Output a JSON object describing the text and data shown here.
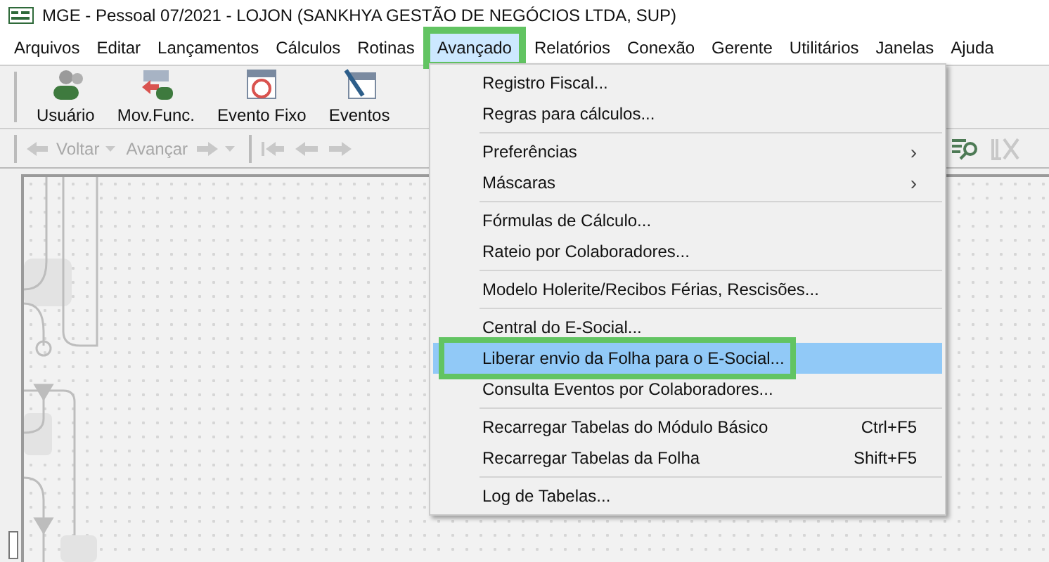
{
  "window": {
    "title": "MGE - Pessoal 07/2021 - LOJON (SANKHYA GESTÃO DE NEGÓCIOS LTDA, SUP)"
  },
  "menubar": [
    {
      "label": "Arquivos",
      "selected": false,
      "highlighted": false
    },
    {
      "label": "Editar",
      "selected": false,
      "highlighted": false
    },
    {
      "label": "Lançamentos",
      "selected": false,
      "highlighted": false
    },
    {
      "label": "Cálculos",
      "selected": false,
      "highlighted": false
    },
    {
      "label": "Rotinas",
      "selected": false,
      "highlighted": false
    },
    {
      "label": "Avançado",
      "selected": true,
      "highlighted": true
    },
    {
      "label": "Relatórios",
      "selected": false,
      "highlighted": false
    },
    {
      "label": "Conexão",
      "selected": false,
      "highlighted": false
    },
    {
      "label": "Gerente",
      "selected": false,
      "highlighted": false
    },
    {
      "label": "Utilitários",
      "selected": false,
      "highlighted": false
    },
    {
      "label": "Janelas",
      "selected": false,
      "highlighted": false
    },
    {
      "label": "Ajuda",
      "selected": false,
      "highlighted": false
    }
  ],
  "toolbar": [
    {
      "label": "Usuário",
      "kind": "users"
    },
    {
      "label": "Mov.Func.",
      "kind": "move"
    },
    {
      "label": "Evento Fixo",
      "kind": "calendar"
    },
    {
      "label": "Eventos",
      "kind": "events"
    }
  ],
  "navigation": [
    {
      "label": "Voltar",
      "disabled": true,
      "kind": "back"
    },
    {
      "label": "Avançar",
      "disabled": true,
      "kind": "forward"
    }
  ],
  "menu": [
    {
      "kind": "item",
      "label": "Registro Fiscal...",
      "selected": false,
      "highlighted": false
    },
    {
      "kind": "item",
      "label": "Regras para cálculos...",
      "selected": false,
      "highlighted": false
    },
    {
      "kind": "separator"
    },
    {
      "kind": "submenu",
      "label": "Preferências",
      "arrow": "›",
      "selected": false,
      "highlighted": false
    },
    {
      "kind": "submenu",
      "label": "Máscaras",
      "arrow": "›",
      "selected": false,
      "highlighted": false
    },
    {
      "kind": "separator"
    },
    {
      "kind": "item",
      "label": "Fórmulas de Cálculo...",
      "selected": false,
      "highlighted": false
    },
    {
      "kind": "item",
      "label": "Rateio por Colaboradores...",
      "selected": false,
      "highlighted": false
    },
    {
      "kind": "separator"
    },
    {
      "kind": "item",
      "label": "Modelo Holerite/Recibos Férias, Rescisões...",
      "selected": false,
      "highlighted": false
    },
    {
      "kind": "separator"
    },
    {
      "kind": "item",
      "label": "Central do E-Social...",
      "selected": false,
      "highlighted": false
    },
    {
      "kind": "item",
      "label": "Liberar envio da Folha para o E-Social...",
      "selected": true,
      "highlighted": true
    },
    {
      "kind": "item",
      "label": "Consulta Eventos por Colaboradores...",
      "selected": false,
      "highlighted": false
    },
    {
      "kind": "separator"
    },
    {
      "kind": "item",
      "label": "Recarregar Tabelas do Módulo Básico",
      "shortcut": "Ctrl+F5",
      "selected": false,
      "highlighted": false
    },
    {
      "kind": "item",
      "label": "Recarregar Tabelas da Folha",
      "shortcut": "Shift+F5",
      "selected": false,
      "highlighted": false
    },
    {
      "kind": "separator"
    },
    {
      "kind": "item",
      "label": "Log de Tabelas...",
      "selected": false,
      "highlighted": false
    }
  ]
}
